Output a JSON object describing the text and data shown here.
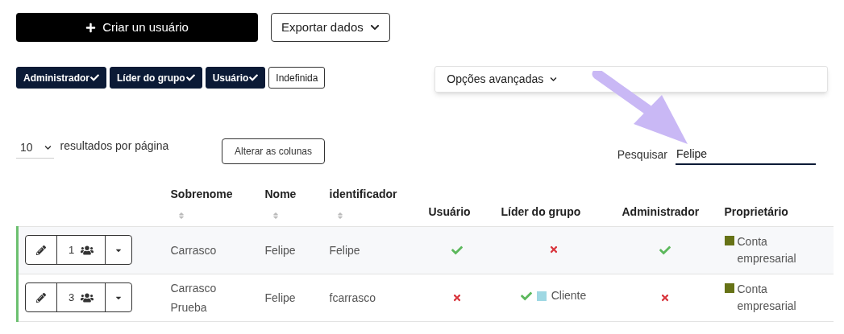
{
  "actions": {
    "create_button": "Criar un usuário",
    "export_button": "Exportar dados"
  },
  "filters": [
    {
      "label": "Administrador",
      "selected": true
    },
    {
      "label": "Líder do grupo",
      "selected": true
    },
    {
      "label": "Usuário",
      "selected": true
    },
    {
      "label": "Indefinida",
      "selected": false
    }
  ],
  "advanced_options": {
    "label": "Opções avançadas",
    "expanded": false
  },
  "page_size": {
    "value": "10",
    "label": "resultados por página"
  },
  "columns_button": "Alterar as colunas",
  "search": {
    "label": "Pesquisar",
    "value": "Felipe"
  },
  "table": {
    "columns": [
      {
        "label": "Sobrenome",
        "sortable": true
      },
      {
        "label": "Nome",
        "sortable": true
      },
      {
        "label": "identificador",
        "sortable": true
      },
      {
        "label": "Usuário",
        "sortable": false
      },
      {
        "label": "Líder do grupo",
        "sortable": false
      },
      {
        "label": "Administrador",
        "sortable": false
      },
      {
        "label": "Proprietário",
        "sortable": false
      }
    ],
    "rows": [
      {
        "count": "1",
        "sobrenome": "Carrasco",
        "nome": "Felipe",
        "identificador": "Felipe",
        "usuario": true,
        "lider": false,
        "group": null,
        "administrador": true,
        "owner": {
          "label": "Conta empresarial",
          "color": "#667216"
        }
      },
      {
        "count": "3",
        "sobrenome": "Carrasco Prueba",
        "nome": "Felipe",
        "identificador": "fcarrasco",
        "usuario": false,
        "lider": true,
        "group": {
          "label": "Cliente",
          "color": "#9fd8e3"
        },
        "administrador": false,
        "owner": {
          "label": "Conta empresarial",
          "color": "#667216"
        }
      }
    ]
  }
}
